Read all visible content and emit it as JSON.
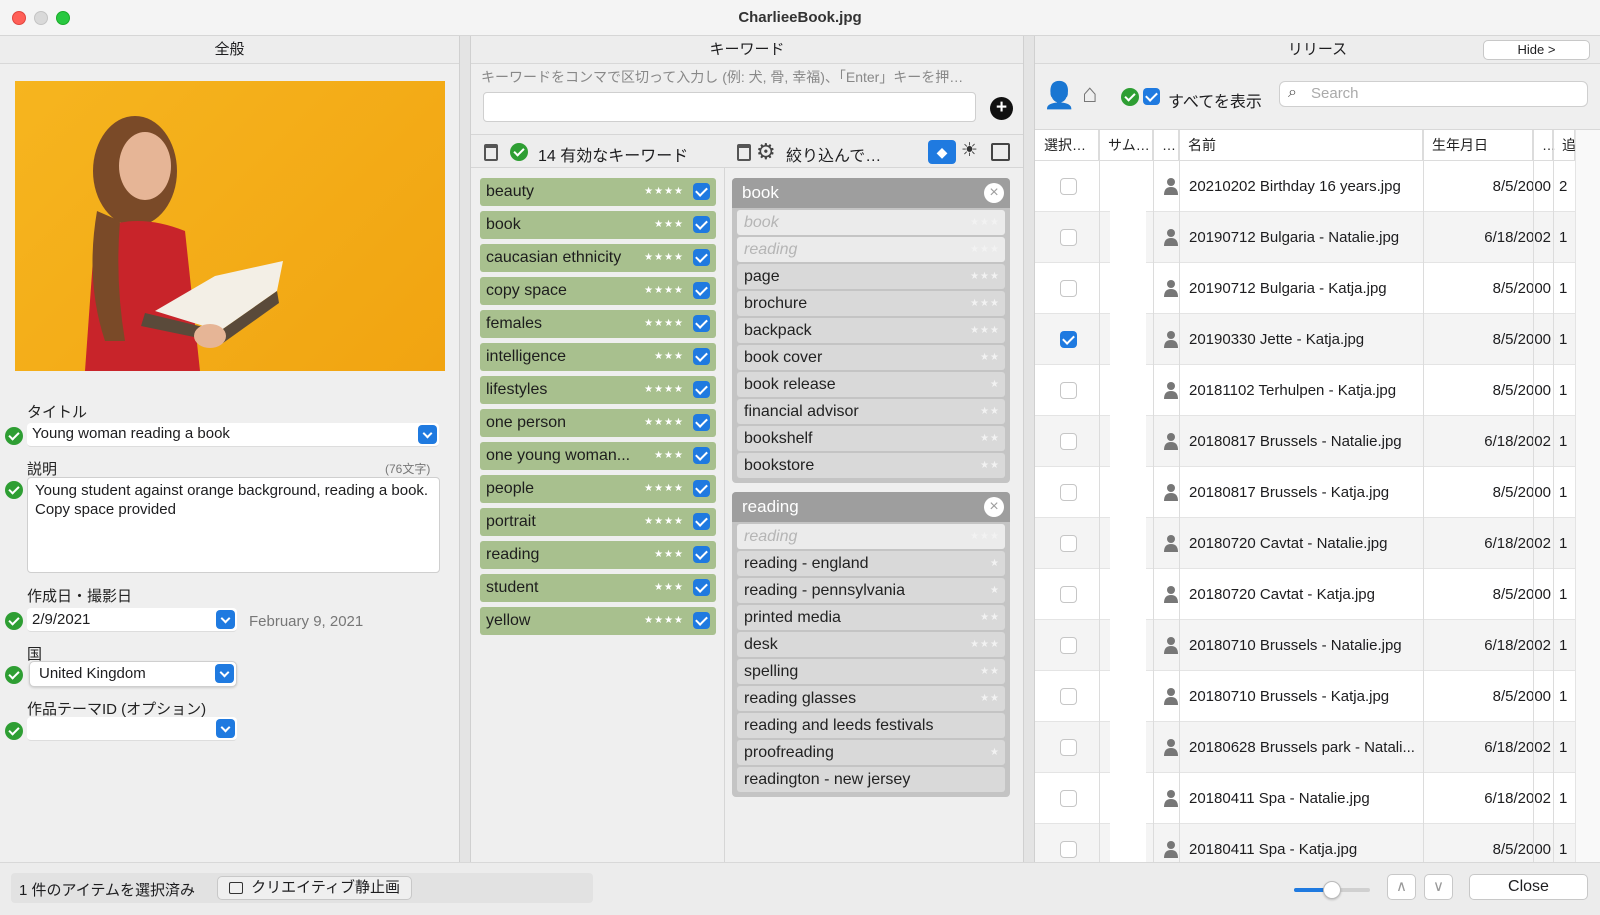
{
  "window": {
    "title": "CharlieeBook.jpg"
  },
  "general": {
    "header": "全般",
    "title_label": "タイトル",
    "title_value": "Young woman reading a book",
    "desc_label": "説明",
    "desc_count": "(76文字)",
    "desc_value": "Young student against orange background, reading a book. Copy space provided",
    "date_label": "作成日・撮影日",
    "date_value": "2/9/2021",
    "date_long": "February 9, 2021",
    "country_label": "国",
    "country_value": "United Kingdom",
    "theme_label": "作品テーマID (オプション)",
    "theme_value": ""
  },
  "keywords": {
    "header": "キーワード",
    "hint": "キーワードをコンマで区切って入力し (例: 犬, 骨, 幸福)、「Enter」キーを押…",
    "count_label": "14 有効なキーワード",
    "filter_label": "絞り込んで…",
    "items": [
      {
        "label": "beauty",
        "stars": "★★★★"
      },
      {
        "label": "book",
        "stars": "★★★"
      },
      {
        "label": "caucasian ethnicity",
        "stars": "★★★★"
      },
      {
        "label": "copy space",
        "stars": "★★★★"
      },
      {
        "label": "females",
        "stars": "★★★★"
      },
      {
        "label": "intelligence",
        "stars": "★★★"
      },
      {
        "label": "lifestyles",
        "stars": "★★★★"
      },
      {
        "label": "one person",
        "stars": "★★★★"
      },
      {
        "label": "one young woman...",
        "stars": "★★★"
      },
      {
        "label": "people",
        "stars": "★★★★"
      },
      {
        "label": "portrait",
        "stars": "★★★★"
      },
      {
        "label": "reading",
        "stars": "★★★"
      },
      {
        "label": "student",
        "stars": "★★★"
      },
      {
        "label": "yellow",
        "stars": "★★★★"
      }
    ],
    "groups": [
      {
        "title": "book",
        "items": [
          {
            "label": "book",
            "stars": "★★★",
            "dim": true
          },
          {
            "label": "reading",
            "stars": "★★★",
            "dim": true
          },
          {
            "label": "page",
            "stars": "★★★"
          },
          {
            "label": "brochure",
            "stars": "★★★"
          },
          {
            "label": "backpack",
            "stars": "★★★"
          },
          {
            "label": "book cover",
            "stars": "★★"
          },
          {
            "label": "book release",
            "stars": "★"
          },
          {
            "label": "financial advisor",
            "stars": "★★"
          },
          {
            "label": "bookshelf",
            "stars": "★★"
          },
          {
            "label": "bookstore",
            "stars": "★★"
          }
        ]
      },
      {
        "title": "reading",
        "items": [
          {
            "label": "reading",
            "stars": "★★★",
            "dim": true
          },
          {
            "label": "reading - england",
            "stars": "★"
          },
          {
            "label": "reading - pennsylvania",
            "stars": "★"
          },
          {
            "label": "printed media",
            "stars": "★★"
          },
          {
            "label": "desk",
            "stars": "★★★"
          },
          {
            "label": "spelling",
            "stars": "★★"
          },
          {
            "label": "reading glasses",
            "stars": "★★"
          },
          {
            "label": "reading and leeds festivals",
            "stars": ""
          },
          {
            "label": "proofreading",
            "stars": "★"
          },
          {
            "label": "readington - new jersey",
            "stars": ""
          }
        ]
      }
    ]
  },
  "release": {
    "header": "リリース",
    "hide_label": "Hide >",
    "show_all": "すべてを表示",
    "search_placeholder": "Search",
    "columns": [
      "選択…",
      "サム…",
      "…",
      "名前",
      "生年月日",
      "…",
      "追"
    ],
    "rows": [
      {
        "name": "20210202 Birthday 16 years.jpg",
        "date": "8/5/2000",
        "add": "2",
        "checked": false
      },
      {
        "name": "20190712 Bulgaria - Natalie.jpg",
        "date": "6/18/2002",
        "add": "1",
        "checked": false
      },
      {
        "name": "20190712 Bulgaria - Katja.jpg",
        "date": "8/5/2000",
        "add": "1",
        "checked": false
      },
      {
        "name": "20190330 Jette - Katja.jpg",
        "date": "8/5/2000",
        "add": "1",
        "checked": true
      },
      {
        "name": "20181102 Terhulpen - Katja.jpg",
        "date": "8/5/2000",
        "add": "1",
        "checked": false
      },
      {
        "name": "20180817 Brussels - Natalie.jpg",
        "date": "6/18/2002",
        "add": "1",
        "checked": false
      },
      {
        "name": "20180817 Brussels - Katja.jpg",
        "date": "8/5/2000",
        "add": "1",
        "checked": false
      },
      {
        "name": "20180720 Cavtat - Natalie.jpg",
        "date": "6/18/2002",
        "add": "1",
        "checked": false
      },
      {
        "name": "20180720 Cavtat - Katja.jpg",
        "date": "8/5/2000",
        "add": "1",
        "checked": false
      },
      {
        "name": "20180710 Brussels - Natalie.jpg",
        "date": "6/18/2002",
        "add": "1",
        "checked": false
      },
      {
        "name": "20180710 Brussels - Katja.jpg",
        "date": "8/5/2000",
        "add": "1",
        "checked": false
      },
      {
        "name": "20180628 Brussels park - Natali...",
        "date": "6/18/2002",
        "add": "1",
        "checked": false
      },
      {
        "name": "20180411 Spa - Natalie.jpg",
        "date": "6/18/2002",
        "add": "1",
        "checked": false
      },
      {
        "name": "20180411 Spa - Katja.jpg",
        "date": "8/5/2000",
        "add": "1",
        "checked": false
      }
    ]
  },
  "status": {
    "selected": "1 件のアイテムを選択済み",
    "type": "クリエイティブ静止画",
    "close": "Close"
  },
  "colors": {
    "accent": "#1f7ae0",
    "keyword_green": "#a8c08e",
    "ok_green": "#2e9e33"
  }
}
